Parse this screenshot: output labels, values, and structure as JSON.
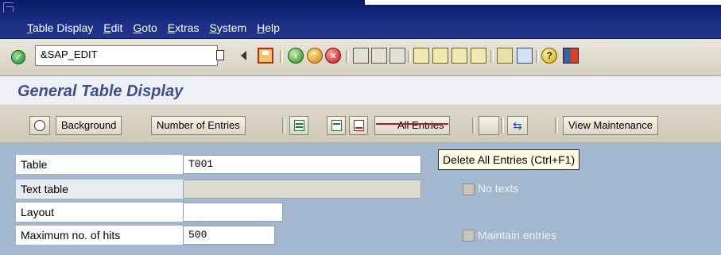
{
  "menu": {
    "items": [
      "Table Display",
      "Edit",
      "Goto",
      "Extras",
      "System",
      "Help"
    ]
  },
  "toolbar": {
    "command_value": "&SAP_EDIT"
  },
  "title": "General Table Display",
  "app_toolbar": {
    "background_label": "Background",
    "number_label": "Number of Entries",
    "all_entries_label": "All Entries",
    "view_maintenance_label": "View Maintenance"
  },
  "tooltip": "Delete All Entries   (Ctrl+F1)",
  "form": {
    "table_label": "Table",
    "table_value": "T001",
    "text_table_label": "Text table",
    "layout_label": "Layout",
    "max_hits_label": "Maximum no. of hits",
    "max_hits_value": "500",
    "no_texts_label": "No texts",
    "maintain_label": "Maintain entries"
  },
  "colors": {
    "menubar": "#1a2e86",
    "title": "#3f4e8c",
    "selection_area": "#a3b8cf"
  }
}
